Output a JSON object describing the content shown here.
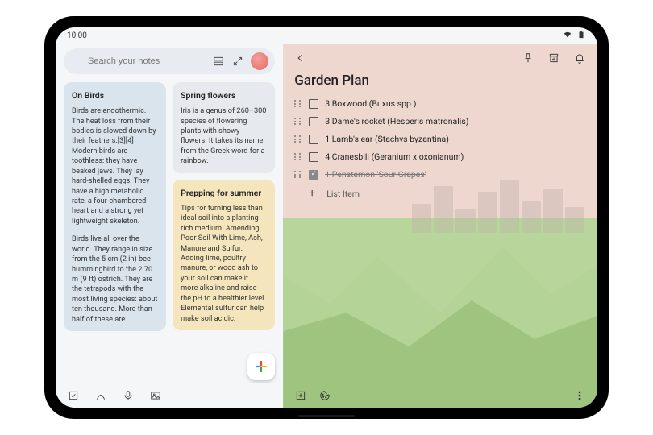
{
  "statusbar": {
    "time": "10:00"
  },
  "search": {
    "placeholder": "Search your notes"
  },
  "notes": {
    "onBirds": {
      "title": "On Birds",
      "p1": "Birds are endothermic. The heat loss from their bodies is slowed down by their feathers.[3][4] Modern birds are toothless: they have beaked jaws. They lay hard-shelled eggs. They have a high metabolic rate, a four-chambered heart and a strong yet lightweight skeleton.",
      "p2": "Birds live all over the world. They range in size from the 5 cm (2 in) bee hummingbird to the 2.70 m (9 ft) ostrich. They are the tetrapods with the most living species: about ten thousand. More than half of these are"
    },
    "springFlowers": {
      "title": "Spring flowers",
      "body": "Iris is a genus of 260–300 species of flowering plants with showy flowers. It takes its name from the Greek word for a rainbow."
    },
    "preppingSummer": {
      "title": "Prepping for summer",
      "body": "Tips for turning less than ideal soil into a planting-rich medium. Amending Poor Soil With Lime, Ash, Manure and Sulfur. Adding lime, poultry manure, or wood ash to your soil can make it more alkaline and raise the pH to a healthier level. Elemental sulfur can help make soil acidic."
    }
  },
  "detail": {
    "title": "Garden Plan",
    "items": [
      {
        "label": "3 Boxwood (Buxus spp.)",
        "done": false
      },
      {
        "label": "3 Dame's rocket (Hesperis matronalis)",
        "done": false
      },
      {
        "label": "1 Lamb's ear (Stachys byzantina)",
        "done": false
      },
      {
        "label": "4 Cranesbill (Geranium x oxonianum)",
        "done": false
      },
      {
        "label": "1 Penstemon 'Sour Grapes'",
        "done": true
      }
    ],
    "addLabel": "List Item"
  }
}
